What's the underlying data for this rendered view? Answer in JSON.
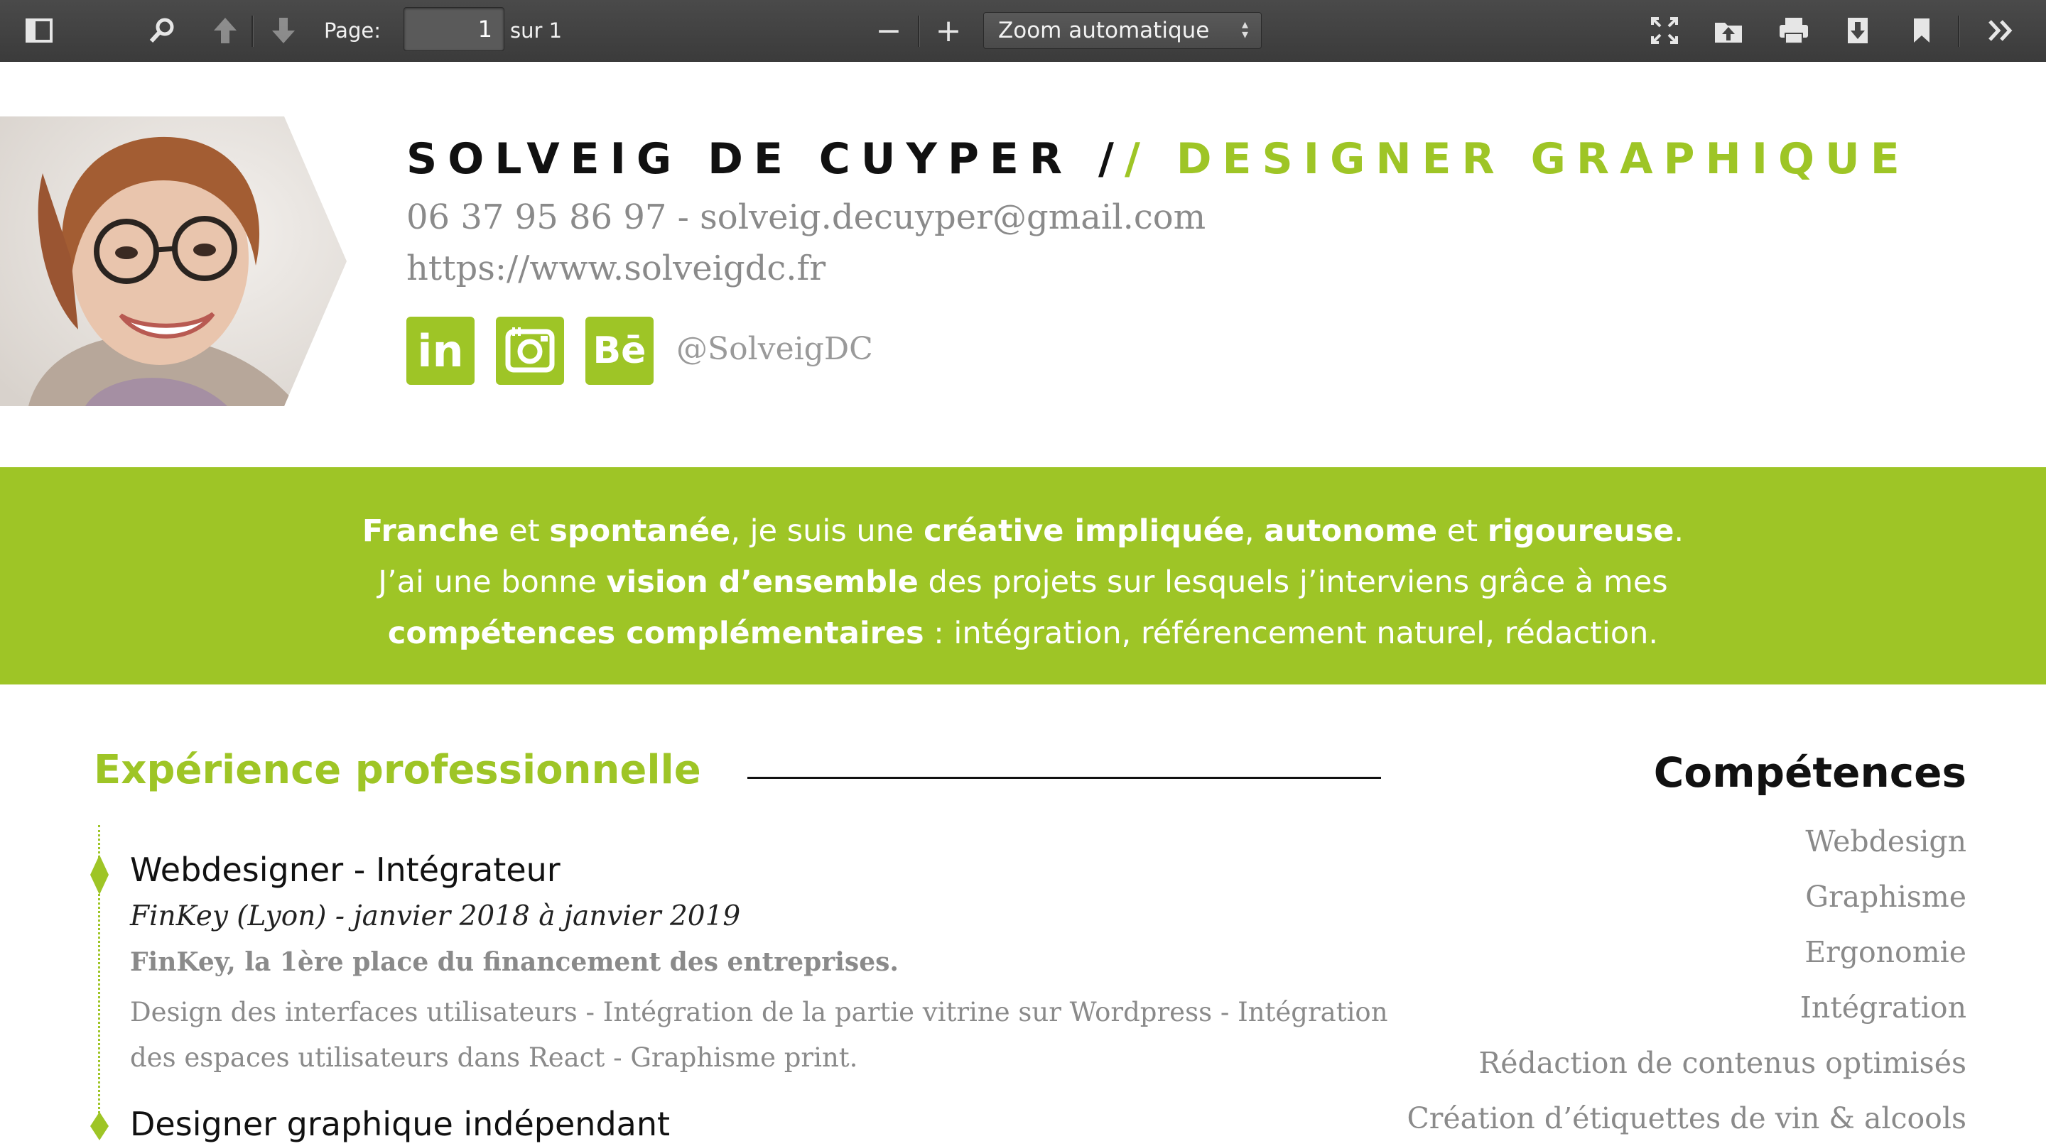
{
  "toolbar": {
    "page_label": "Page:",
    "page_value": "1",
    "page_total": "sur 1",
    "zoom_label": "Zoom automatique",
    "zoom_out": "−",
    "zoom_in": "+"
  },
  "header": {
    "name": "SOLVEIG DE CUYPER",
    "slash_dark": "/",
    "slash_green": "/",
    "title": "DESIGNER GRAPHIQUE",
    "contact_line": "06 37 95 86 97 - solveig.decuyper@gmail.com",
    "website": "https://www.solveigdc.fr",
    "social_handle": "@SolveigDC",
    "social_icons": [
      "linkedin-icon",
      "instagram-icon",
      "behance-icon"
    ],
    "linkedin_text": "in",
    "behance_text": "Bē"
  },
  "intro": {
    "l1": [
      "Franche",
      " et ",
      "spontanée",
      ", je suis une ",
      "créative impliquée",
      ", ",
      "autonome",
      " et ",
      "rigoureuse",
      "."
    ],
    "l2": [
      "J’ai une bonne ",
      "vision d’ensemble",
      " des projets sur lesquels j’interviens grâce à mes"
    ],
    "l3": [
      "compétences complémentaires",
      " : intégration, référencement naturel, rédaction."
    ]
  },
  "experience": {
    "heading": "Expérience professionnelle",
    "jobs": [
      {
        "title": "Webdesigner - Intégrateur",
        "meta": "FinKey (Lyon) - janvier 2018 à janvier 2019",
        "tagline": "FinKey, la 1ère place du financement des entreprises.",
        "description": "Design des interfaces utilisateurs - Intégration de la partie vitrine sur Wordpress - Intégration des espaces utilisateurs dans React - Graphisme print."
      },
      {
        "title": "Designer graphique indépendant"
      }
    ]
  },
  "skills": {
    "heading": "Compétences",
    "items": [
      "Webdesign",
      "Graphisme",
      "Ergonomie",
      "Intégration",
      "Rédaction de contenus optimisés",
      "Création d’étiquettes de vin & alcools"
    ]
  },
  "colors": {
    "accent": "#9ec526",
    "toolbar": "#404040",
    "muted_text": "#8a8a8a"
  }
}
